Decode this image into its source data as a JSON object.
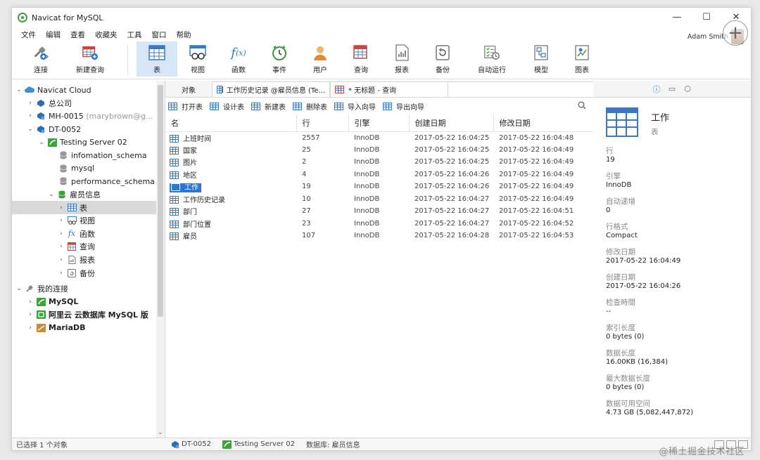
{
  "window": {
    "title": "Navicat for MySQL",
    "controls": [
      "—",
      "☐",
      "✕"
    ]
  },
  "user": {
    "name": "Adam Smith"
  },
  "menu": [
    "文件",
    "编辑",
    "查看",
    "收藏夹",
    "工具",
    "窗口",
    "帮助"
  ],
  "toolbar": {
    "connect": "连接",
    "new_query": "新建查询",
    "items": [
      "表",
      "视图",
      "函数",
      "事件",
      "用户",
      "查询",
      "报表",
      "备份",
      "自动运行",
      "模型",
      "图表"
    ]
  },
  "tree": {
    "cloud": "Navicat Cloud",
    "company": "总公司",
    "mh_name": "MH-0015",
    "mh_owner": "(marybrown@g...",
    "dt": "DT-0052",
    "server": "Testing Server 02",
    "schemas": [
      "infomation_schema",
      "mysql",
      "performance_schema"
    ],
    "db": "雇员信息",
    "db_children": [
      "表",
      "视图",
      "函数",
      "查询",
      "报表",
      "备份"
    ],
    "my_conn": "我的连接",
    "conns": [
      "MySQL",
      "阿里云 云数据库 MySQL 版",
      "MariaDB"
    ]
  },
  "tabs": {
    "object": "对象",
    "tab1": "工作历史记录 @雇员信息 (Te...",
    "tab2": "* 无标题 - 查询"
  },
  "actions": [
    "打开表",
    "设计表",
    "新建表",
    "删除表",
    "导入向导",
    "导出向导"
  ],
  "grid": {
    "headers": [
      "名",
      "行",
      "引擎",
      "创建日期",
      "修改日期"
    ],
    "rows": [
      {
        "name": "上班时间",
        "rows": "2557",
        "engine": "InnoDB",
        "created": "2017-05-22 16:04:25",
        "modified": "2017-05-22 16:04:48"
      },
      {
        "name": "国家",
        "rows": "25",
        "engine": "InnoDB",
        "created": "2017-05-22 16:04:25",
        "modified": "2017-05-22 16:04:49"
      },
      {
        "name": "图片",
        "rows": "2",
        "engine": "InnoDB",
        "created": "2017-05-22 16:04:25",
        "modified": "2017-05-22 16:04:49"
      },
      {
        "name": "地区",
        "rows": "4",
        "engine": "InnoDB",
        "created": "2017-05-22 16:04:26",
        "modified": "2017-05-22 16:04:49"
      },
      {
        "name": "工作",
        "rows": "19",
        "engine": "InnoDB",
        "created": "2017-05-22 16:04:26",
        "modified": "2017-05-22 16:04:49"
      },
      {
        "name": "工作历史记录",
        "rows": "10",
        "engine": "InnoDB",
        "created": "2017-05-22 16:04:27",
        "modified": "2017-05-22 16:04:49"
      },
      {
        "name": "部门",
        "rows": "27",
        "engine": "InnoDB",
        "created": "2017-05-22 16:04:27",
        "modified": "2017-05-22 16:04:51"
      },
      {
        "name": "部门位置",
        "rows": "23",
        "engine": "InnoDB",
        "created": "2017-05-22 16:04:27",
        "modified": "2017-05-22 16:04:52"
      },
      {
        "name": "雇员",
        "rows": "107",
        "engine": "InnoDB",
        "created": "2017-05-22 16:04:28",
        "modified": "2017-05-22 16:04:53"
      }
    ]
  },
  "props": {
    "title": "工作",
    "subtitle": "表",
    "items": [
      {
        "label": "行",
        "value": "19"
      },
      {
        "label": "引擎",
        "value": "InnoDB"
      },
      {
        "label": "自动递增",
        "value": "0"
      },
      {
        "label": "行格式",
        "value": "Compact"
      },
      {
        "label": "修改日期",
        "value": "2017-05-22 16:04:49"
      },
      {
        "label": "创建日期",
        "value": "2017-05-22 16:04:26"
      },
      {
        "label": "检查時間",
        "value": "--"
      },
      {
        "label": "索引长度",
        "value": "0 bytes (0)"
      },
      {
        "label": "数据长度",
        "value": "16.00KB (16,384)"
      },
      {
        "label": "最大数据长度",
        "value": "0 bytes (0)"
      },
      {
        "label": "数据可用空间",
        "value": "4.73 GB (5,082,447,872)"
      }
    ]
  },
  "status": {
    "selected": "已选择 1 个对象",
    "conn": "DT-0052",
    "server": "Testing Server 02",
    "db": "数据库: 雇员信息"
  },
  "watermark": "@稀土掘金技术社区"
}
